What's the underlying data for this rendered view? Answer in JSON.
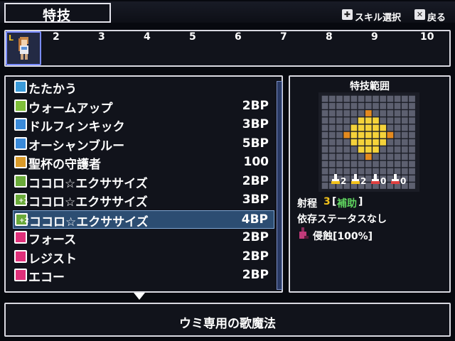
{
  "screen_title": "特技",
  "hints": [
    {
      "icon": "dpad-icon",
      "label": "スキル選択"
    },
    {
      "icon": "x-button-icon",
      "label": "戻る"
    }
  ],
  "party_slots": [
    "2",
    "3",
    "4",
    "5",
    "6",
    "7",
    "8",
    "9",
    "10"
  ],
  "party_leader_badge": "L",
  "skills": [
    {
      "name": "たたかう",
      "cost": "",
      "icon": "sword-icon",
      "color": "#3a9ad9",
      "badge": ""
    },
    {
      "name": "ウォームアップ",
      "cost": "2BP",
      "icon": "plus-icon",
      "color": "#7fbf3a",
      "badge": ""
    },
    {
      "name": "ドルフィンキック",
      "cost": "3BP",
      "icon": "square-icon",
      "color": "#3a8ad9",
      "badge": ""
    },
    {
      "name": "オーシャンブルー",
      "cost": "5BP",
      "icon": "square-icon",
      "color": "#3a8ad9",
      "badge": ""
    },
    {
      "name": "聖杯の守護者",
      "cost": "100",
      "icon": "grail-icon",
      "color": "#d99a2a",
      "badge": ""
    },
    {
      "name": "ココロ☆エクササイズ",
      "cost": "2BP",
      "icon": "music-icon",
      "color": "#6aaa3a",
      "badge": ""
    },
    {
      "name": "ココロ☆エクササイズ",
      "cost": "3BP",
      "icon": "music-icon",
      "color": "#6aaa3a",
      "badge": "+1"
    },
    {
      "name": "ココロ☆エクササイズ",
      "cost": "4BP",
      "icon": "music-icon",
      "color": "#6aaa3a",
      "badge": "+2"
    },
    {
      "name": "フォース",
      "cost": "2BP",
      "icon": "vo-icon",
      "color": "#e0307a",
      "badge": ""
    },
    {
      "name": "レジスト",
      "cost": "2BP",
      "icon": "vo-icon",
      "color": "#e0307a",
      "badge": ""
    },
    {
      "name": "エコー",
      "cost": "2BP",
      "icon": "vo-icon",
      "color": "#e0307a",
      "badge": ""
    }
  ],
  "selected_index": 7,
  "range_panel": {
    "title": "特技範囲",
    "counters": [
      "2",
      "2",
      "0",
      "0"
    ],
    "range_label": "射程",
    "range_value": "3",
    "range_type": "補助",
    "dependency": "依存ステータスなし",
    "effect": "侵蝕[100%]"
  },
  "description": "ウミ専用の歌魔法",
  "colors": {
    "accent": "#f2c21b",
    "range_type": "#5fd35f",
    "orange": "#e48a1f",
    "yellow": "#f4d23a"
  }
}
